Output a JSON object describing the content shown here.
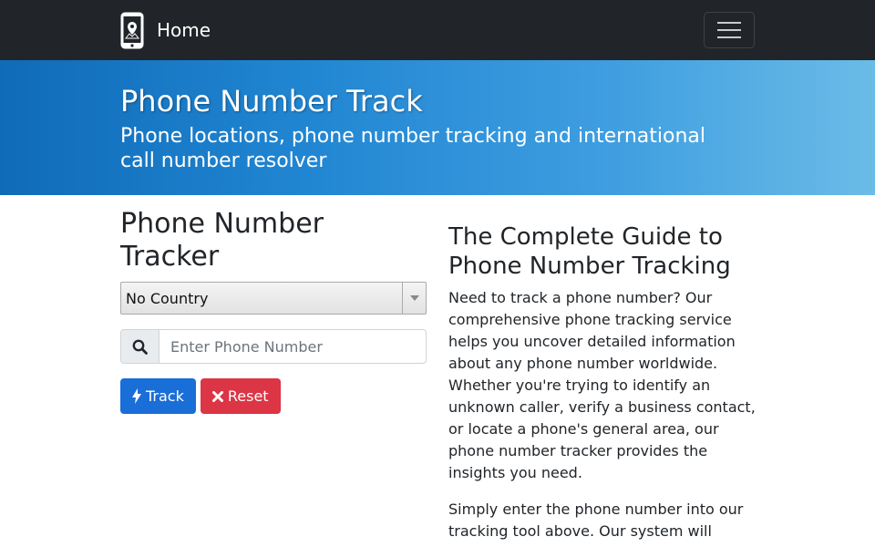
{
  "navbar": {
    "brand_text": "Home",
    "brand_icon": "phone-location-icon",
    "toggler_icon": "hamburger-menu-icon"
  },
  "hero": {
    "title": "Phone Number Track",
    "subtitle": "Phone locations, phone number tracking and international call number resolver"
  },
  "tracker": {
    "title": "Phone Number Tracker",
    "country_select": {
      "selected": "No Country"
    },
    "phone_input": {
      "value": "",
      "placeholder": "Enter Phone Number"
    },
    "search_icon": "search-icon",
    "track_label": "Track",
    "track_icon": "lightning-bolt-icon",
    "reset_label": "Reset",
    "reset_icon": "close-icon"
  },
  "guide": {
    "title": "The Complete Guide to Phone Number Tracking",
    "paragraphs": [
      "Need to track a phone number? Our comprehensive phone tracking service helps you uncover detailed information about any phone number worldwide. Whether you're trying to identify an unknown caller, verify a business contact, or locate a phone's general area, our phone number tracker provides the insights you need.",
      "Simply enter the phone number into our tracking tool above. Our system will"
    ]
  },
  "colors": {
    "navbar_bg": "#212529",
    "hero_gradient_start": "#0f6bb8",
    "hero_gradient_end": "#6bbce7",
    "track_button": "#1a6ed8",
    "reset_button": "#dc3545"
  }
}
